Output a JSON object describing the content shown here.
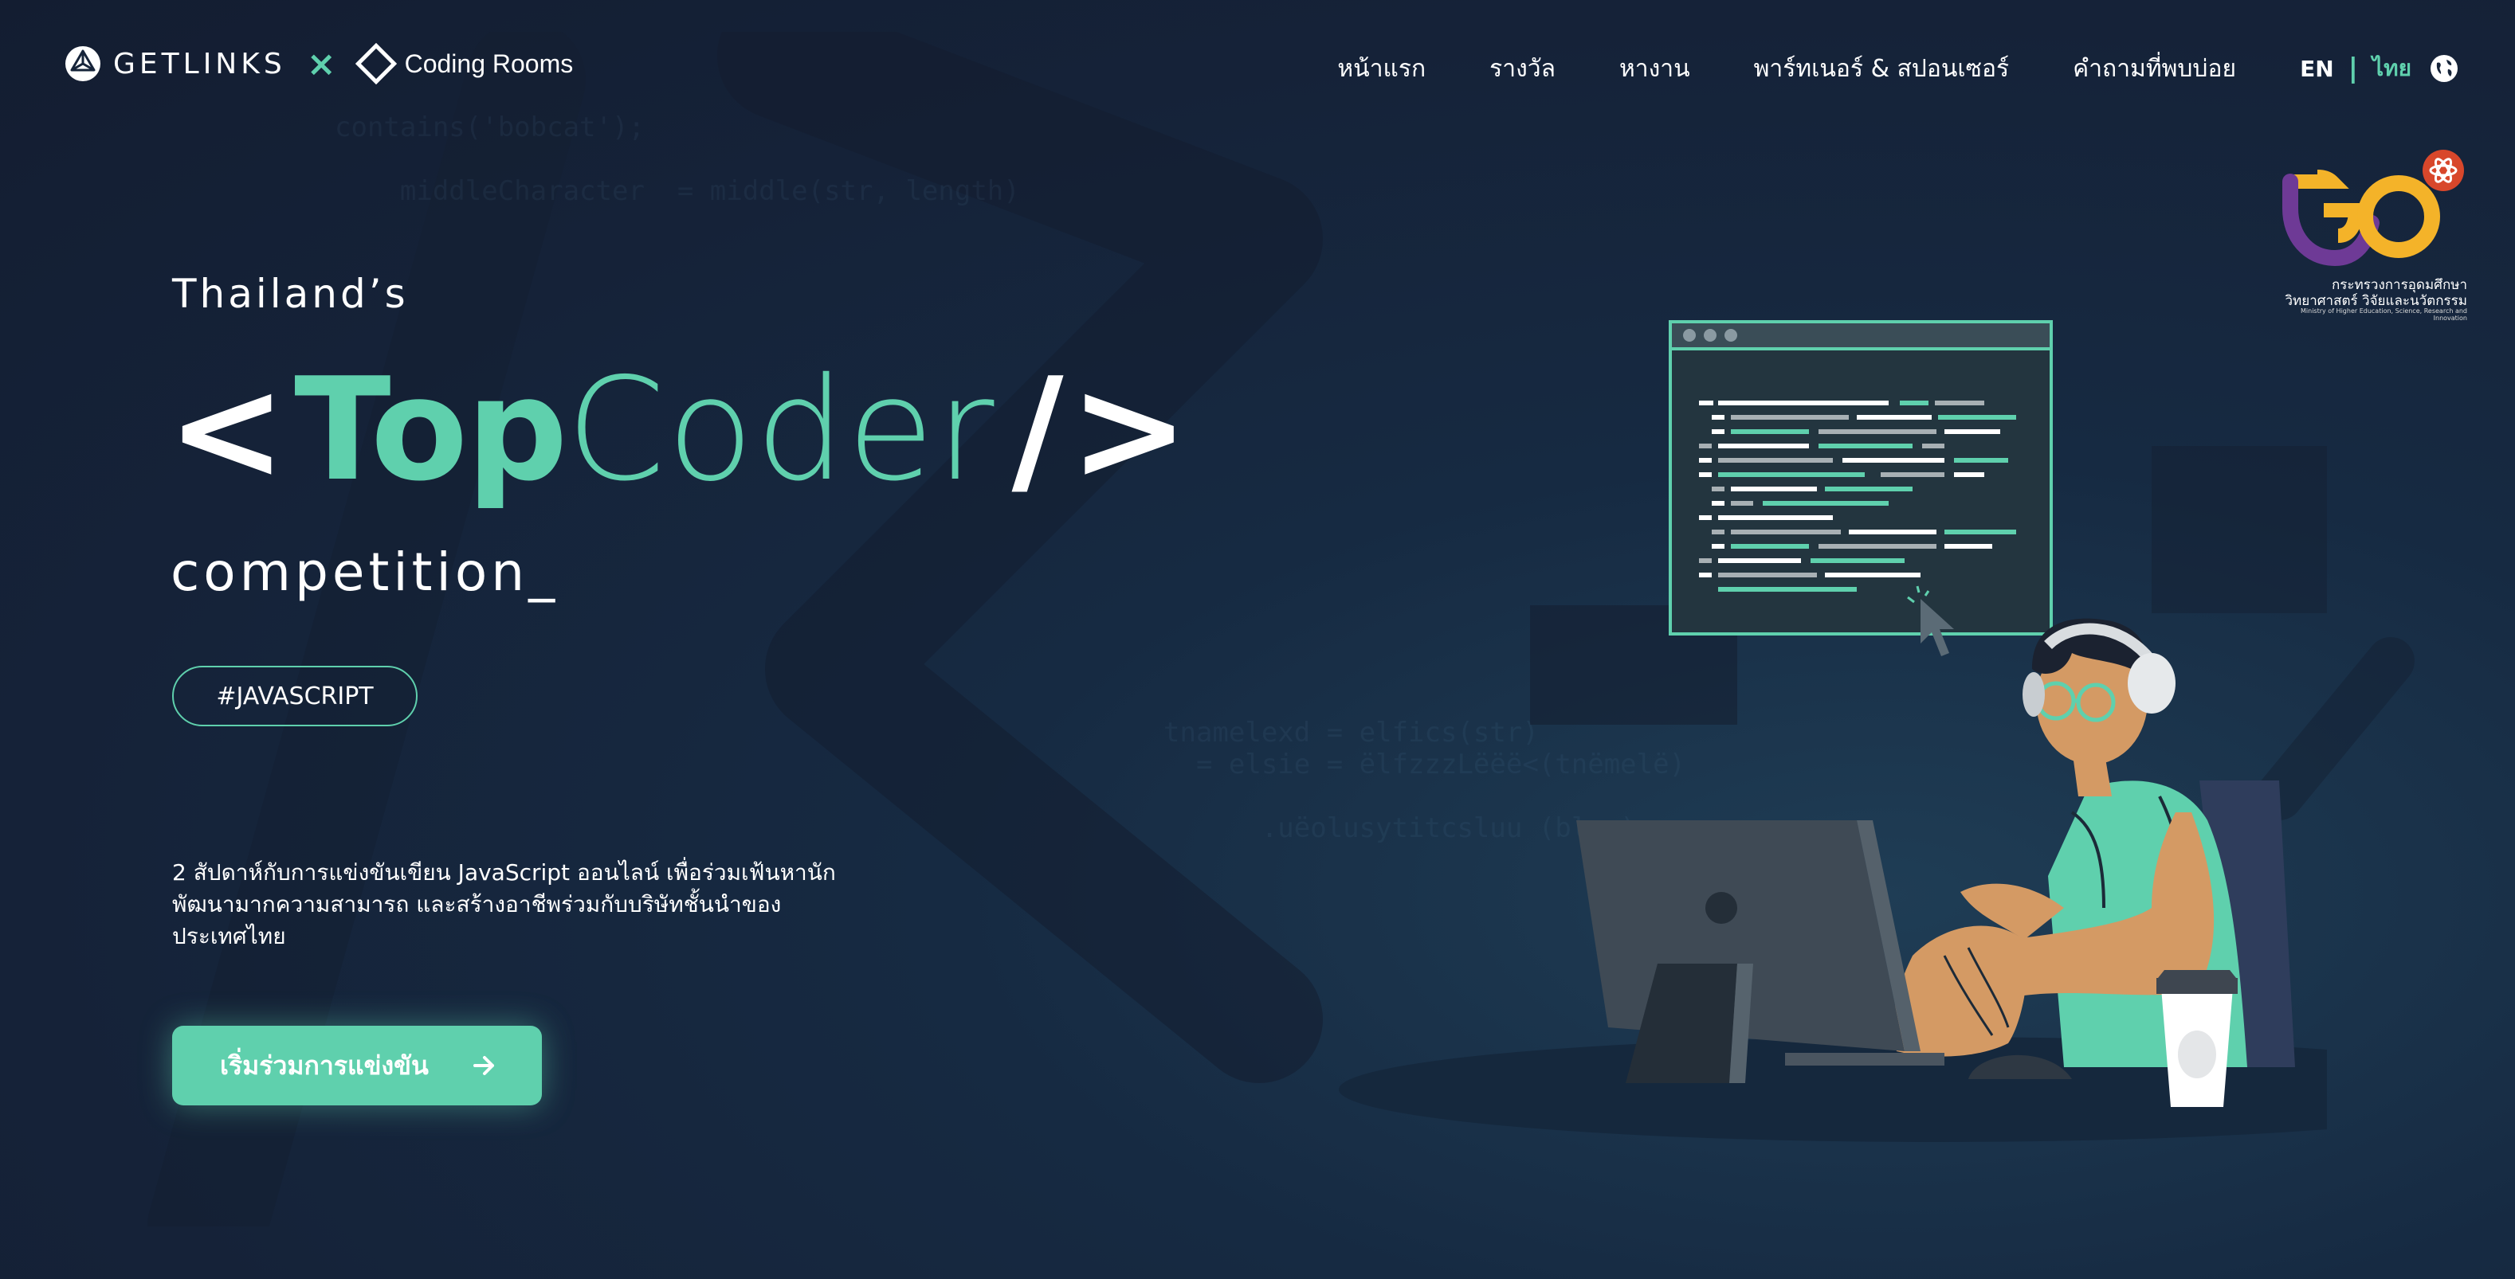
{
  "header": {
    "brand": {
      "getlinks": "GETLINKS",
      "times": "×",
      "coding_rooms": "Coding Rooms"
    },
    "nav": [
      {
        "label": "หน้าแรก"
      },
      {
        "label": "รางวัล"
      },
      {
        "label": "หางาน"
      },
      {
        "label": "พาร์ทเนอร์ & สปอนเซอร์"
      },
      {
        "label": "คำถามที่พบบ่อย"
      }
    ],
    "lang": {
      "en": "EN",
      "separator": "|",
      "th": "ไทย"
    },
    "globe_icon": "globe-icon"
  },
  "ministry": {
    "line1": "กระทรวงการอุดมศึกษา",
    "line2": "วิทยาศาสตร์ วิจัยและนวัตกรรม",
    "line3": "Ministry of Higher Education, Science, Research and Innovation"
  },
  "hero": {
    "eyebrow": "Thailand’s",
    "title": {
      "open": "<",
      "top": "Top",
      "coder": "Coder",
      "slash": "/",
      "close": ">"
    },
    "subtitle": "competition_",
    "tag": "#JAVASCRIPT",
    "description": "2 สัปดาห์กับการแข่งขันเขียน JavaScript ออนไลน์ เพื่อร่วมเฟ้นหานักพัฒนามากความสามารถ และสร้างอาชีพร่วมกับบริษัทชั้นนำของประเทศไทย",
    "cta_label": "เริ่มร่วมการแข่งขัน"
  },
  "colors": {
    "accent": "#5fd0ad",
    "background": "#152238",
    "text": "#ffffff"
  }
}
